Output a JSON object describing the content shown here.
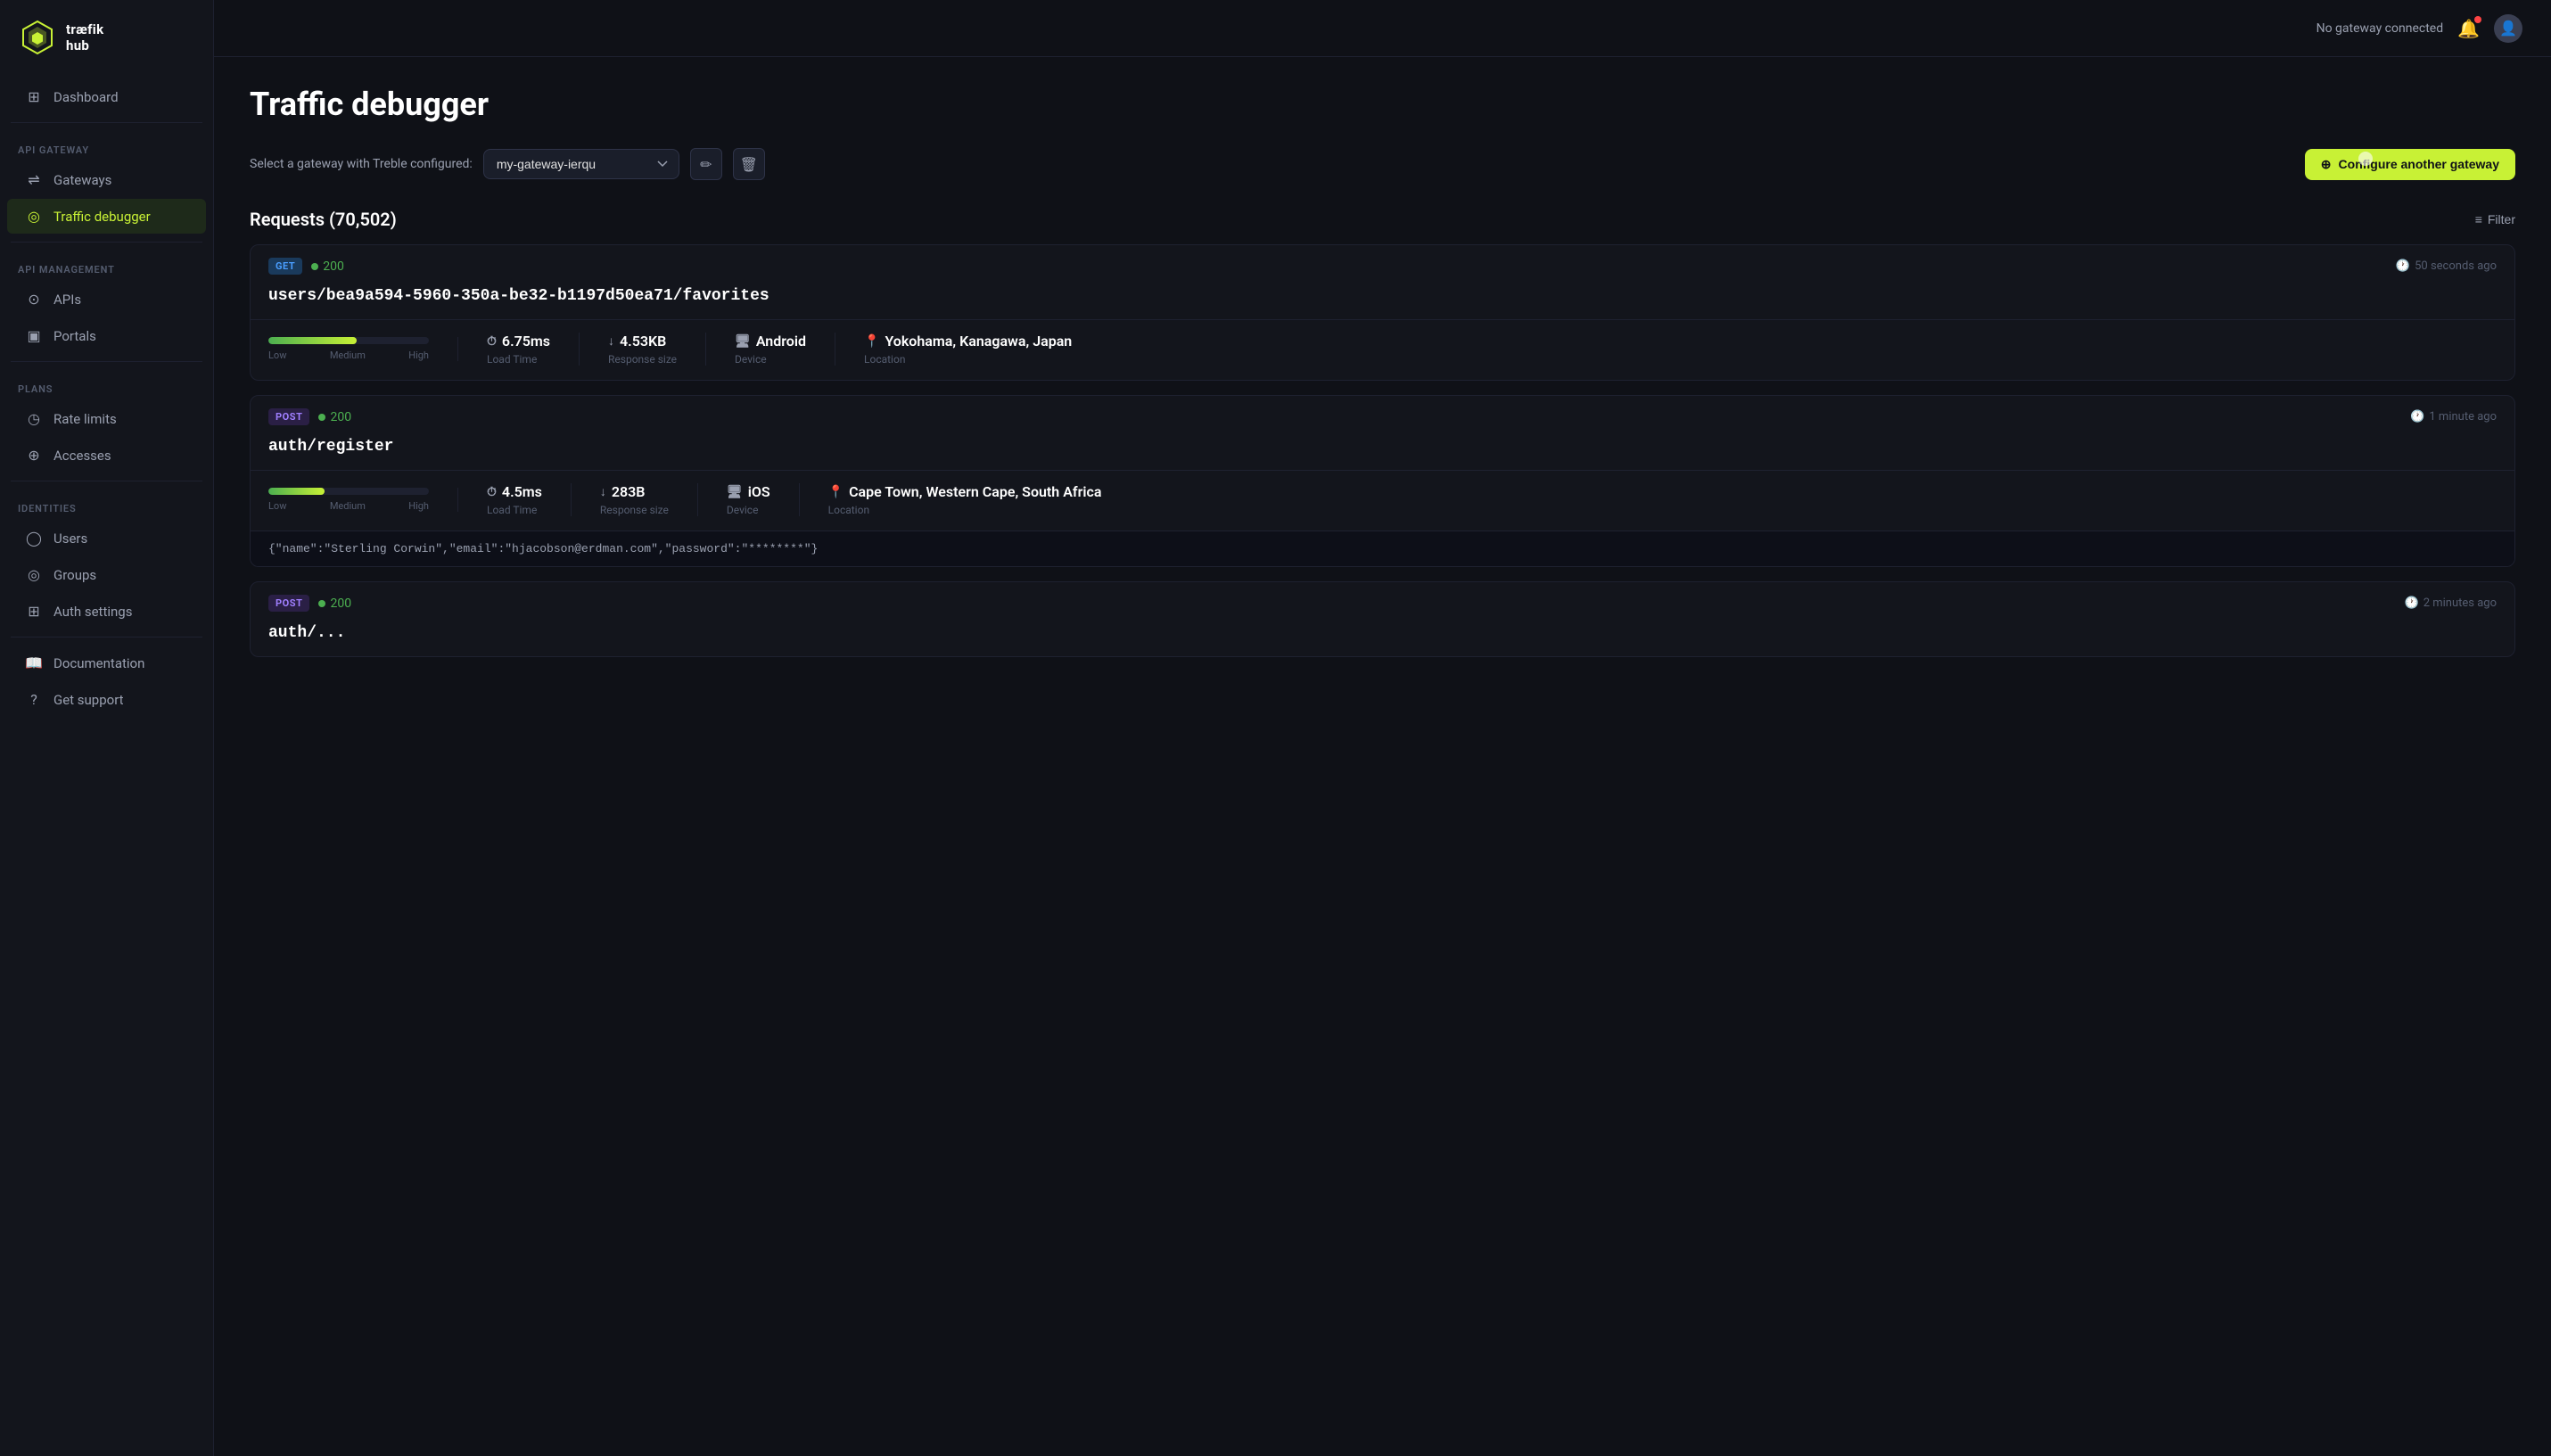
{
  "sidebar": {
    "logo": {
      "name": "træfik hub",
      "line1": "træfik",
      "line2": "hub"
    },
    "nav": [
      {
        "id": "dashboard",
        "label": "Dashboard",
        "icon": "⊞",
        "section": null,
        "active": false
      },
      {
        "id": "section-api-gateway",
        "label": "API GATEWAY",
        "type": "section"
      },
      {
        "id": "gateways",
        "label": "Gateways",
        "icon": "⇌",
        "active": false
      },
      {
        "id": "traffic-debugger",
        "label": "Traffic debugger",
        "icon": "◎",
        "active": true
      },
      {
        "id": "section-api-management",
        "label": "API MANAGEMENT",
        "type": "section"
      },
      {
        "id": "apis",
        "label": "APIs",
        "icon": "⊙",
        "active": false
      },
      {
        "id": "portals",
        "label": "Portals",
        "icon": "▣",
        "active": false
      },
      {
        "id": "section-plans",
        "label": "PLANS",
        "type": "section"
      },
      {
        "id": "rate-limits",
        "label": "Rate limits",
        "icon": "◷",
        "active": false
      },
      {
        "id": "accesses",
        "label": "Accesses",
        "icon": "⊕",
        "active": false
      },
      {
        "id": "section-identities",
        "label": "IDENTITIES",
        "type": "section"
      },
      {
        "id": "users",
        "label": "Users",
        "icon": "◯",
        "active": false
      },
      {
        "id": "groups",
        "label": "Groups",
        "icon": "◎",
        "active": false
      },
      {
        "id": "auth-settings",
        "label": "Auth settings",
        "icon": "⊞",
        "active": false
      }
    ],
    "bottom": [
      {
        "id": "documentation",
        "label": "Documentation",
        "icon": "📖"
      },
      {
        "id": "get-support",
        "label": "Get support",
        "icon": "?"
      }
    ]
  },
  "topbar": {
    "status": "No gateway connected",
    "bell_label": "notifications",
    "avatar_label": "user-menu"
  },
  "page": {
    "title": "Traffic debugger",
    "gateway_label": "Select a gateway with Treble configured:",
    "gateway_value": "my-gateway-ierqu",
    "configure_btn": "Configure another gateway",
    "requests_title": "Requests (70,502)",
    "filter_label": "Filter"
  },
  "requests": [
    {
      "method": "GET",
      "status": "200",
      "time_ago": "50 seconds ago",
      "endpoint": "users/bea9a594-5960-350a-be32-b1197d50ea71/favorites",
      "load_pct": 55,
      "load_time": "6.75ms",
      "response_size": "4.53KB",
      "device": "Android",
      "location": "Yokohama, Kanagawa, Japan",
      "body": null
    },
    {
      "method": "POST",
      "status": "200",
      "time_ago": "1 minute ago",
      "endpoint": "auth/register",
      "load_pct": 35,
      "load_time": "4.5ms",
      "response_size": "283B",
      "device": "iOS",
      "location": "Cape Town, Western Cape, South Africa",
      "body": "{\"name\":\"Sterling Corwin\",\"email\":\"hjacobson@erdman.com\",\"password\":\"********\"}"
    },
    {
      "method": "POST",
      "status": "200",
      "time_ago": "2 minutes ago",
      "endpoint": "auth/...",
      "load_pct": 0,
      "load_time": "",
      "response_size": "",
      "device": "",
      "location": "",
      "body": null
    }
  ],
  "icons": {
    "plus": "+",
    "edit": "✏",
    "delete": "🗑",
    "clock": "🕐",
    "filter": "≡",
    "timer": "⏱",
    "download": "↓",
    "monitor": "🖥",
    "location": "📍"
  }
}
